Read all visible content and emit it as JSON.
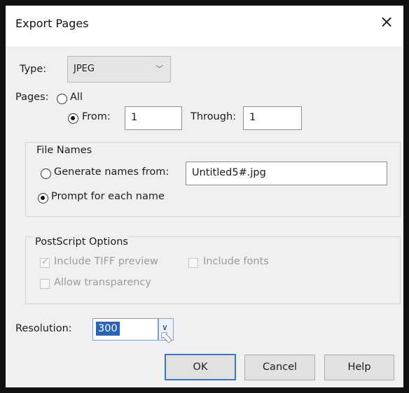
{
  "dialog": {
    "title": "Export Pages",
    "close_glyph": "×",
    "close_icon": "close-icon"
  },
  "type": {
    "label": "Type:",
    "selected": "JPEG",
    "chevron_glyph": "﹀"
  },
  "pages": {
    "label": "Pages:",
    "all_label": "All",
    "all_checked": false,
    "from_label": "From:",
    "from_checked": true,
    "from_value": "1",
    "through_label": "Through:",
    "through_value": "1"
  },
  "file_names": {
    "group_label": "File Names",
    "generate_label": "Generate names from:",
    "generate_checked": false,
    "generate_value": "Untitled5#.jpg",
    "prompt_label": "Prompt for each name",
    "prompt_checked": true
  },
  "postscript": {
    "group_label": "PostScript Options",
    "include_tiff_label": "Include TIFF preview",
    "include_tiff_checked": true,
    "include_fonts_label": "Include fonts",
    "include_fonts_checked": false,
    "allow_transparency_label": "Allow transparency",
    "allow_transparency_checked": false
  },
  "resolution": {
    "label": "Resolution:",
    "value": "300",
    "chevron_glyph": "∨"
  },
  "buttons": {
    "ok": "OK",
    "cancel": "Cancel",
    "help": "Help"
  },
  "cursor_glyph": "⬉"
}
